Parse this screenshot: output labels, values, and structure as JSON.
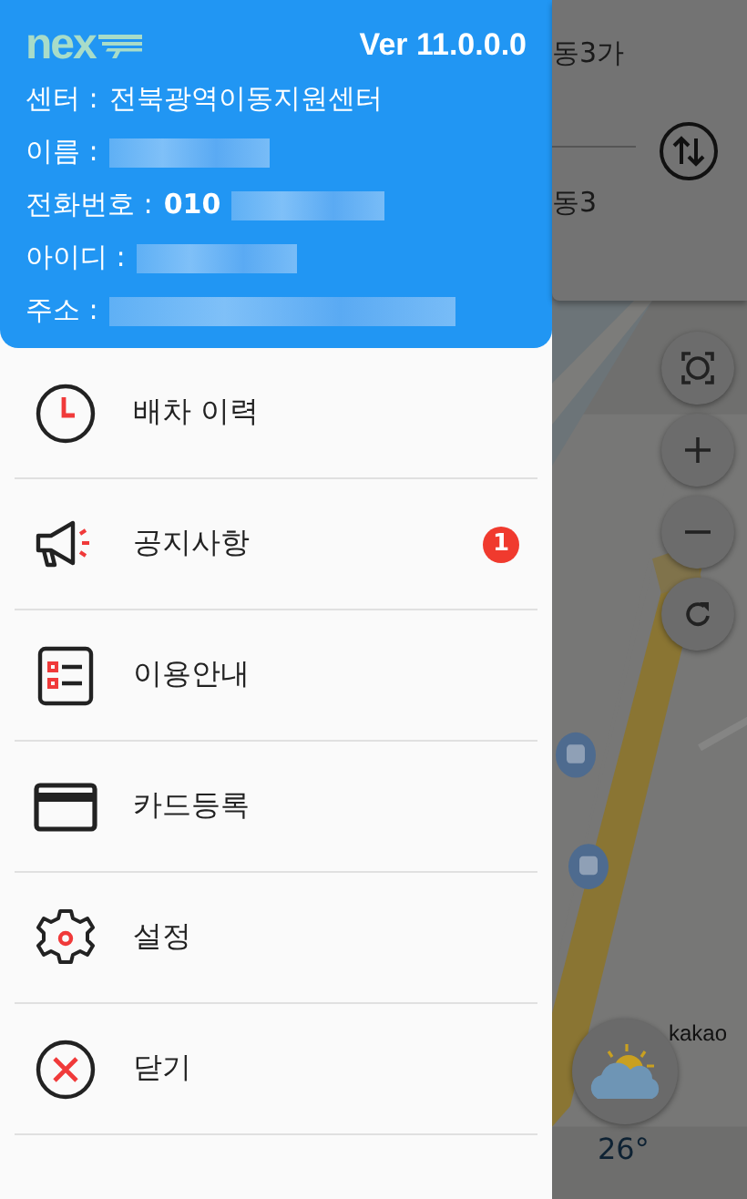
{
  "drawer": {
    "logo": "nex",
    "version": "Ver 11.0.0.0",
    "fields": [
      {
        "label": "센터 :",
        "value": "전북광역이동지원센터",
        "redacted": false
      },
      {
        "label": "이름 :",
        "redacted": true
      },
      {
        "label": "전화번호 :",
        "value": "010",
        "redacted": true
      },
      {
        "label": "아이디 :",
        "redacted": true
      },
      {
        "label": "주소 :",
        "redacted": true
      }
    ],
    "menu": [
      {
        "label": "배차 이력",
        "kind": "history"
      },
      {
        "label": "공지사항",
        "kind": "notice",
        "badge": "1"
      },
      {
        "label": "이용안내",
        "kind": "guide"
      },
      {
        "label": "카드등록",
        "kind": "card"
      },
      {
        "label": "설정",
        "kind": "settings"
      },
      {
        "label": "닫기",
        "kind": "close"
      }
    ]
  },
  "background": {
    "route": {
      "origin": "동3가",
      "destination": "동3"
    },
    "map_attribution": "kakao",
    "weather": {
      "temperature": "26°"
    }
  }
}
